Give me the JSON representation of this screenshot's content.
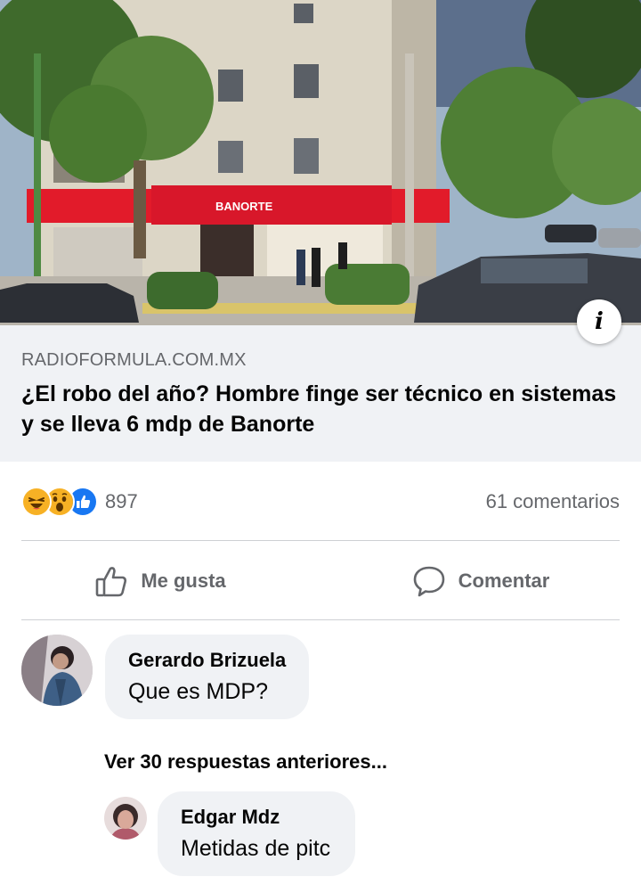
{
  "post": {
    "link_preview": {
      "image": {
        "description_icon": "info-icon",
        "storefront_text": "BANORTE"
      },
      "domain": "RADIOFORMULA.COM.MX",
      "title": "¿El robo del año? Hombre finge ser técnico en sistemas y se lleva 6 mdp de Banorte"
    },
    "reactions": {
      "icons": [
        "haha-reaction-icon",
        "wow-reaction-icon",
        "like-reaction-icon"
      ],
      "count": "897",
      "comments_count": "61 comentarios"
    },
    "actions": {
      "like_label": "Me gusta",
      "comment_label": "Comentar"
    }
  },
  "comments": [
    {
      "author": "Gerardo Brizuela",
      "text": "Que es MDP?"
    }
  ],
  "view_previous_replies": "Ver 30 respuestas anteriores...",
  "replies": [
    {
      "author": "Edgar Mdz",
      "text": "Metidas de pitc"
    }
  ],
  "colors": {
    "secondary_text": "#65676b",
    "bubble_bg": "#f0f2f5",
    "like_blue": "#1877f2",
    "banorte_red": "#e21b2a",
    "emoji_yellow": "#f7b125"
  }
}
